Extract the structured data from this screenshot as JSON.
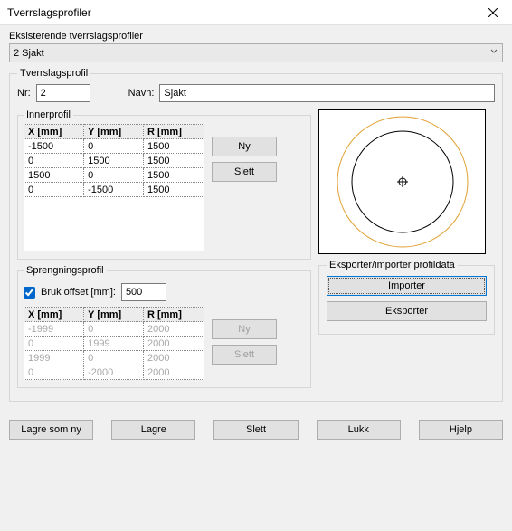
{
  "window": {
    "title": "Tverrslagsprofiler"
  },
  "existing": {
    "label": "Eksisterende tverrslagsprofiler",
    "selected": "2 Sjakt"
  },
  "profile_head": {
    "legend": "Tverrslagsprofil",
    "nr_label": "Nr:",
    "nr_value": "2",
    "name_label": "Navn:",
    "name_value": "Sjakt"
  },
  "inner": {
    "legend": "Innerprofil",
    "headers": [
      "X [mm]",
      "Y [mm]",
      "R [mm]"
    ],
    "rows": [
      [
        "-1500",
        "0",
        "1500"
      ],
      [
        "0",
        "1500",
        "1500"
      ],
      [
        "1500",
        "0",
        "1500"
      ],
      [
        "0",
        "-1500",
        "1500"
      ]
    ]
  },
  "inner_buttons": {
    "new": "Ny",
    "delete": "Slett"
  },
  "spreng": {
    "legend": "Sprengningsprofil",
    "offset_label": "Bruk offset [mm]:",
    "offset_value": "500",
    "headers": [
      "X [mm]",
      "Y [mm]",
      "R [mm]"
    ],
    "rows": [
      [
        "-1999",
        "0",
        "2000"
      ],
      [
        "0",
        "1999",
        "2000"
      ],
      [
        "1999",
        "0",
        "2000"
      ],
      [
        "0",
        "-2000",
        "2000"
      ]
    ]
  },
  "spreng_buttons": {
    "new": "Ny",
    "delete": "Slett"
  },
  "export_group": {
    "legend": "Eksporter/importer profildata",
    "import": "Importer",
    "export": "Eksporter"
  },
  "footer": {
    "save_as_new": "Lagre som ny",
    "save": "Lagre",
    "delete": "Slett",
    "close": "Lukk",
    "help": "Hjelp"
  }
}
